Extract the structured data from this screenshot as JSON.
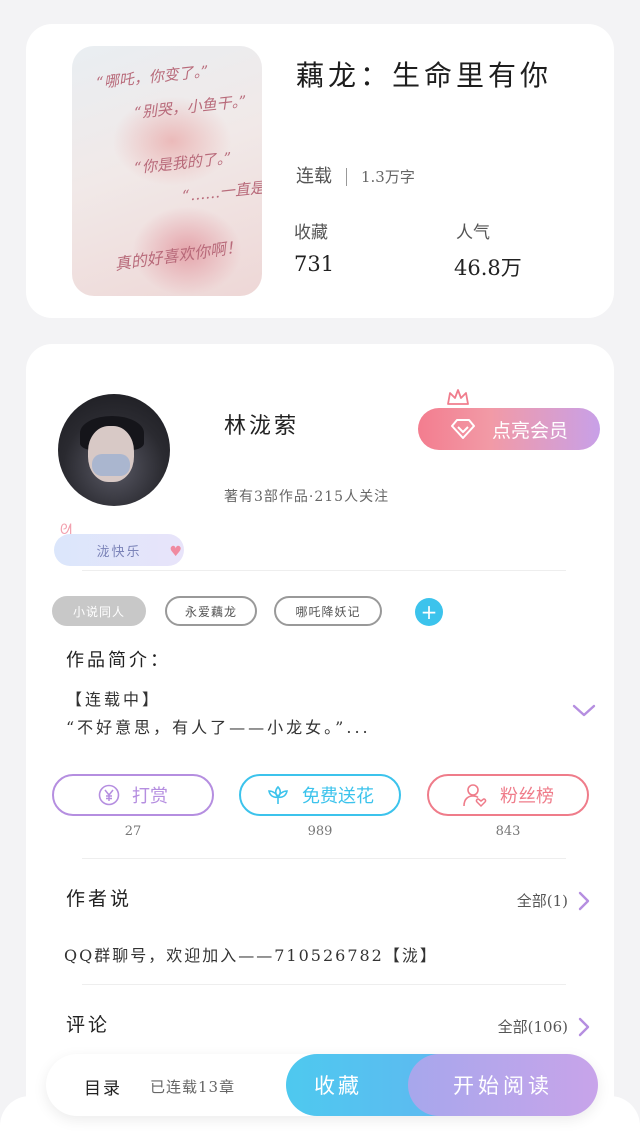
{
  "book": {
    "cover_lines": [
      "“哪吒，你变了。”",
      "“别哭，小鱼干。”",
      "“你是我的了。”",
      "“……一直是。”",
      "真的好喜欢你啊！"
    ],
    "title": "藕龙：生命里有你",
    "status": "连载",
    "word_count": "1.3万字",
    "collect_label": "收藏",
    "collect_value": "731",
    "popularity_label": "人气",
    "popularity_value": "46.8万"
  },
  "author": {
    "name": "林泷萦",
    "info": "著有3部作品·215人关注",
    "vip_button": "点亮会员",
    "badge": "泷快乐"
  },
  "tags": [
    "小说同人",
    "永爱藕龙",
    "哪吒降妖记"
  ],
  "intro": {
    "title": "作品简介：",
    "line1": "【连载中】",
    "line2": "“不好意思，有人了——小龙女。”..."
  },
  "actions": [
    {
      "label": "打赏",
      "count": "27",
      "color": "#b58ee0"
    },
    {
      "label": "免费送花",
      "count": "989",
      "color": "#3cc3ec"
    },
    {
      "label": "粉丝榜",
      "count": "843",
      "color": "#ef7c8a"
    }
  ],
  "author_says": {
    "title": "作者说",
    "more": "全部(1)",
    "text": "QQ群聊号，欢迎加入——710526782【泷】"
  },
  "comments": {
    "title": "评论",
    "more": "全部(106)"
  },
  "bottom_bar": {
    "catalog": "目录",
    "status": "已连载13章",
    "collect": "收藏",
    "read": "开始阅读"
  },
  "colors": {
    "accent_purple": "#b58ee0",
    "accent_blue": "#3cc3ec",
    "accent_pink": "#ef7c8a"
  }
}
